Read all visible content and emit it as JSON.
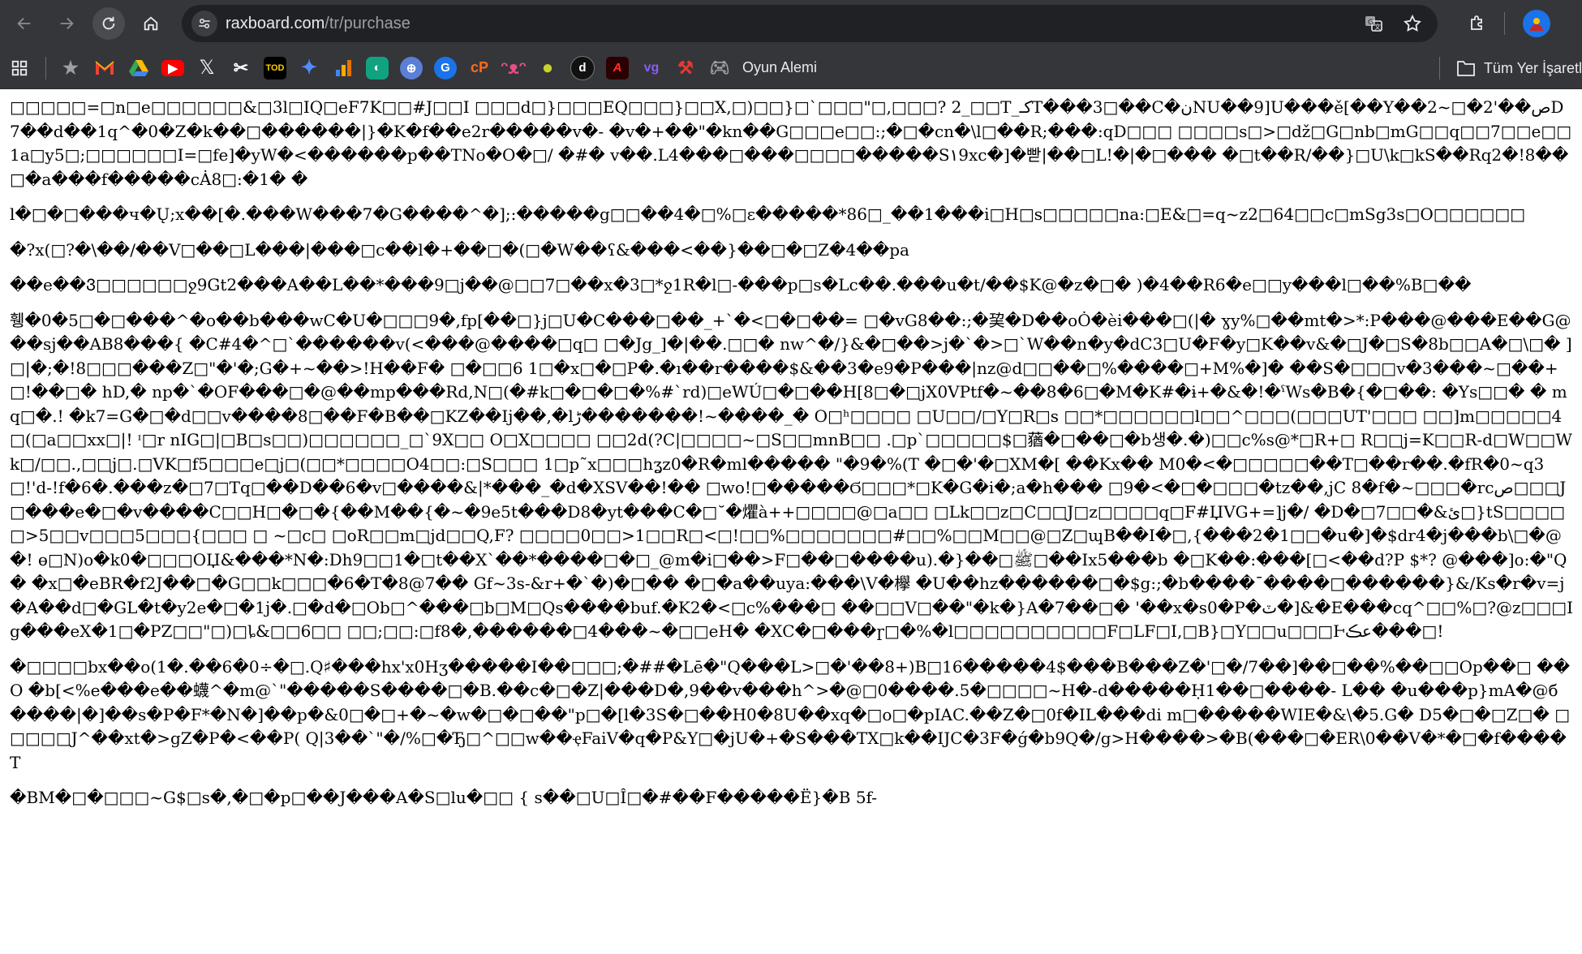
{
  "browser": {
    "url_host": "raxboard.com",
    "url_path": "/tr/purchase",
    "bookmarks": [
      {
        "icon": "apps-grid-icon"
      },
      {
        "icon": "star-icon"
      },
      {
        "icon": "gmail-icon",
        "color": "#ea4335"
      },
      {
        "icon": "google-drive-icon",
        "color": "#34a853"
      },
      {
        "icon": "youtube-icon",
        "color": "#ff0000"
      },
      {
        "icon": "x-twitter-icon",
        "color": "#ffffff"
      },
      {
        "icon": "scissors-icon",
        "color": "#ffffff"
      },
      {
        "icon": "tod-icon",
        "color": "#ffcc00"
      },
      {
        "icon": "gemini-icon",
        "color": "#4f8cff"
      },
      {
        "icon": "analytics-icon",
        "color": "#f9ab00"
      },
      {
        "icon": "chat-bubble-icon",
        "color": "#10a37f"
      },
      {
        "icon": "globe-icon",
        "color": "#5a7fd6"
      },
      {
        "icon": "g-circle-icon",
        "color": "#1a73e8"
      },
      {
        "icon": "cp-icon",
        "color": "#ff6b1a"
      },
      {
        "icon": "smile-icon",
        "color": "#e84c8a"
      },
      {
        "icon": "lemon-icon",
        "color": "#c9d42a"
      },
      {
        "icon": "d-circle-icon",
        "color": "#111111"
      },
      {
        "icon": "a-red-icon",
        "color": "#cc1f1f"
      },
      {
        "icon": "vg-icon",
        "color": "#8b5cf6"
      },
      {
        "icon": "brush-icon",
        "color": "#e53935"
      },
      {
        "icon": "gamepad-icon",
        "color": "#9aa0a6",
        "label": "Oyun Alemi"
      }
    ],
    "all_bookmarks_label": "Tüm Yer İşaretl"
  },
  "page": {
    "paragraphs": [
      "□□□□□=□n□e□□□□□□&□3l□IQ□eF7K□□#J□□I □□□d□}□□□EQ□□□}□□X,□)□□}□`□□□\"□,□□□? 2_□□T_کـT���3□��C�نNU��9]U���ě[��Y��2~□�2'��صD7��d��1q^�0�Z�k��□������|}�K�f��e2r�����v�- �v�+��\"�kn��G□□□e□□:;�□�cn�\\l□��R;���:qD□□□ □□□□s□>□dž□G□nb□mG□□q□□7□□e□□1a□y5□;□□□□□□I=□fe]�yW�<������p��TNo�O�□/ �#� v��.L4���□���□□□□�����S۱9xc�]�빧|��□L!�|�□��� �□t��R/��}□U\\k□kS��Rq2�!8��□�a���f�����cȦ8□:�1� �",
      "l�□�□���ч�Ų;x��[�.���W���7�G����^�];:�����g□□��4�□%□ɛ�����*86□_��1���i□H□s□□□□□na:□E&□=q~z2□64□□c□mSg3s□O□□□□□□",
      "�?x(□?�\\��/��V□��□L���|���□c��l�+��□�(□�W��ʕ&���<��}��□�□Z�4��pa",
      "��e��Ვ□□□□□□ջ9Gt2���A��L��*���9□j��@□□7□��x�3□*ջ1R�l□-���p□s�Lc��.���u�t/��$K@�z�□� )�4��R6�e□□y���l□��%B□��",
      "휑�0�5□�□���^�o��b���wC�U�□□□9�,fp[��□}j□U�C���□��_+`�<□�□��= □�vG8��:;�巭�D��oȮ�èi���□(|� ɣy%□��mt�>*:P���@���E��G@��sj��AB8���{ �C#4�^□`������v(<���@����□q□ □�Jg_]�|��.□□� nw^�/}&�□��>j�`�>□`W��n�y�dC3□U�F�y□K��v&�□J�□S�8b□□A�□\\□� ]□|�;�!8□□□���Z□\"�'�;G�+~��>!H��F� □�□□6 1□�x□�□P�.�ı��r����$&��3�e9�P���|nz@d□□��□%����□+M%�]� ��S�□□□v�3���~□��+□!��□� hD,� np�`�OF���□�@��mp���Rd,N□(�#k□�□�□�%#`rd)□eWÚ□�□��H[8□�□jX0VPtf�~��8�6□�M�K#�ɨ+�&�!�ˁWs�B�{�□��: �Ys□□� � mq□�.! �k7=G�□�d□□v����8□��F�B��□KZ��Ij��,�lڑ�������!~����_� O□ʰ□□□□ □U□□/□Y□R□s □□*□□□□□□l□□^□□□(□□□UT'□□□ □□]m□□□□□4□(□a□□xx□|! ᶦ□r nIG□|□B□s□□)□□□□□□_□`9X□□ O□X□□□□ □□2d(?C|□□□□~□S□□mnB□□ .□p`□□□□□$□蕕�□��□�b생�.�)□□c%s@*□R+□ R□□j=K□□R-d□W□□Wk□/□□.,□□j□.□VK□f5□□□e□j□(□□*□□□□O4□□:□S□□□ 1□p˜x□□□hʓz0�R�ml����� \"�9�%(T �□�'�□XM�[ ��Kx�� M0�<�□□□□□��T□��r��.�fR�0~q3□!'d-!f�6�.���z�□7□Tq□��D��6�v□����&|*���_�d�XSV��!�� □wo!□�����Ϭ□□□*□K�G�i�;a�h��� □9�<�□�□□□�tz��,jC 8�f�~□□□�rcص□□□J□���e�□�v����C□□H□�□�{��M��{�~�9e5t���D8�yt���C�□˘�爠à++□□□□@□a□□ □Lk□□z□C□□J□z□□□□q□F#ЏVG+=]j�/ �D�□7□□�&ئ□}tS□□□□□>5□□v□□□5□□□{□□□ □ ~□c□ □oR□□m□jd□□Q,F? □□□□0□□>1□□R□<□!□□%□□□□□□□#□□%□□M□□@□Z□ɰB��I�□,{���2�1□□�u�]�$dr4�j���b\\□�@�! ɵ□N)o�k0�□□□OЏ&���*N�:Dh9□□1�□t��X`��*����□�□_@m�i□��>F□��□����u).�}��□ﷺ□��Ix5���b �□K��:���[□<��d?P $*? @���]o:�\"Q� �x□�eBR�f2J��□�G□□k□□□�6�T�8@7�� Gf~3s-&r+�`�)�□�� �□�a��uya:���\\V�欅 �U��hz������□�$g:;�b����¯����□������}&/Ks�r�v=j�A��d□�GL�t�y2e�□�1j�.□�d�□Ob□^���□b□M□Qs����buf.�K2�<□c%���□ ��□□V□��\"�k�}A�7��□� '��x�s0�P�ٽ�]&�E���cq^□□%□?@z□□□Ig���eX�1□�PZ□□\"□)□ȴ&□□6□□ □□;□□:□f8�,������□4���~�□□eH� �XC�□���ɼ□�%�l□□□□□□□□□□F□LF□I,□B}□Y□□u□□□Ⱶعڪ���□!",
      "�□□□□bx��o(1�.��6�0÷�□.Q♯���hx'x0Hʒ�����I��□□□;�##�Lē�\"Q���L>□�'��8+)B□16�����4$���B���Z�'□�/7��]��□��%��□□Op��□ ��O �b[<%e���e��蠛^�m@`\"�����S����□�B.��c�□�Z|���D�,9��v���h^>�@□0����.5�□□□□~H�-d�����Ḥ1��□����- L�� �u���p}mA�@б����|�]��s�P�F*�N�]��p�&0□�□+�~�w�□�□��\"p□�[l�3S�□��H0�8U��xq�□o□�pIAC.��Z�□0f�IL���di m□�����WIE�&\\�5.G� D5�□�□Z□� □□□□□J^��xt�>gZ�P�<��P( Q|3��`\"�/%□�Ђ□^□□w��ҿFaiV�q�P&Y□�jU�+�S���TX□k��IJC�3F�ǵ�b9Q�/g>H����>�B(���□�ER\\0��V�*�□�f����T",
      "�BM�□�□□□~G$□s�,�□�p□��J���A�S□lu�□□ { s��□U□Î□�#��F�����Ë}�B 5f-"
    ]
  }
}
